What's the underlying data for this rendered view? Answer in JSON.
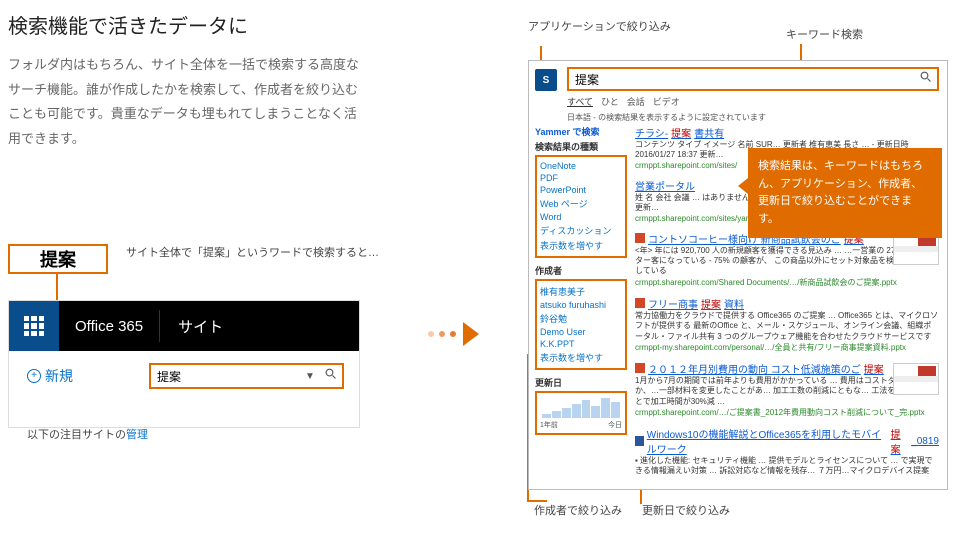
{
  "hero": {
    "title": "検索機能で活きたデータに",
    "body": "フォルダ内はもちろん、サイト全体を一括で検索する高度なサーチ機能。誰が作成したかを検索して、作成者を絞り込むことも可能です。貴重なデータも埋もれてしまうことなく活用できます。"
  },
  "search_chip": {
    "value": "提案",
    "caption": "サイト全体で「提案」というワードで検索すると…"
  },
  "o365": {
    "brand": "Office 365",
    "site": "サイト",
    "new_label": "新規",
    "search_value": "提案",
    "manage_prefix": "以下の注目サイトの",
    "manage_link": "管理"
  },
  "annotations": {
    "app": "アプリケーションで絞り込み",
    "keyword": "キーワード検索",
    "author": "作成者で絞り込み",
    "date": "更新日で絞り込み",
    "callout": "検索結果は、キーワードはもちろん、アプリケーション、作成者、更新日で絞り込むことができます。"
  },
  "results": {
    "search_value": "提案",
    "tabs": [
      "すべて",
      "ひと",
      "会話",
      "ビデオ"
    ],
    "note": "日本語 - の検索結果を表示するように設定されています",
    "yammer_heading": "Yammer で検索",
    "facets": {
      "type": {
        "title": "検索結果の種類",
        "items": [
          "OneNote",
          "PDF",
          "PowerPoint",
          "Web ページ",
          "Word",
          "ディスカッション",
          "表示数を増やす"
        ]
      },
      "author": {
        "title": "作成者",
        "items": [
          "椎有恵美子",
          "atsuko furuhashi",
          "鈴谷勉",
          "Demo User",
          "K.K.PPT",
          "表示数を増やす"
        ]
      },
      "date": {
        "title": "更新日",
        "axis_left": "1年前",
        "axis_right": "今日"
      }
    },
    "hits": [
      {
        "title_pre": "チラシ-",
        "title_hl": "提案",
        "title_post": "書共有",
        "body": "コンテンツ タイプ イメージ 名前 SUR… 更新者 椎有恵美 長さ … - 更新日時 2016/01/27 18:37 更新…",
        "url": "crmppt.sharepoint.com/sites/"
      },
      {
        "title_pre": "営業ポータル",
        "title_hl": "",
        "title_post": "",
        "body": "姓 名 会社 会議 … はありません ▸ チラシ-提案書共有… SUR15_Device_Family_06 更新…",
        "url": "crmppt.sharepoint.com/sites/yanu_zenpan_eigyou"
      },
      {
        "icon": "pp",
        "title_pre": "コントソコーヒー様向け 新商品試飲会のご",
        "title_hl": "提案",
        "title_post": "",
        "body": "<年> 年には 920,700 人の新規顧客を獲得できる見込み … …一営業の 27% がリピーター客になっている - 75% の顧客が、 この商品以外にセット対象品を検討 1,点購入している",
        "url": "crmppt.sharepoint.com/Shared Documents/…/新商品試飲会のご提案.pptx",
        "thumb": true
      },
      {
        "icon": "pp",
        "title_pre": "フリー商事",
        "title_hl": "提案",
        "title_post": "資料",
        "body": "常力協働力をクラウドで提供する Office365 のご提案 … Office365 とは、マイクロソフトが提供する 最新のOffice と、メール・スケジュール、オンライン会議、組織ポータル・ファイル共有 3 つのグループウェア機能を合わせたクラウドサービスです",
        "url": "crmppt-my.sharepoint.com/personal/…/全員と共有/フリー商事提案資料.pptx"
      },
      {
        "icon": "pp",
        "title_pre": "２０１２年月別費用の動向 コスト低減施策のご",
        "title_hl": "提案",
        "title_post": "",
        "body": "1月から7月の期間では前年よりも費用がかかっている … 費用はコストダウンのなか、…一部材料を変更したことがあ… 加工工数の削減にともな… 工法を変更することで加工時間が30%減 …",
        "url": "crmppt.sharepoint.com/…/ご提案書_2012年費用動向コスト削減について_完.pptx",
        "thumb": true
      },
      {
        "icon": "w",
        "title_pre": "Windows10の機能解説とOffice365を利用したモバイルワーク",
        "title_hl": "提案",
        "title_post": "_0819",
        "body": "▪ 進化した機能: セキュリティ機能 … 提供モデルとライセンスについて … で実現できる情報漏えい対策 … 訴訟対応など情報を残存… ７万円…マイクロデバイス提案",
        "url": ""
      }
    ]
  }
}
